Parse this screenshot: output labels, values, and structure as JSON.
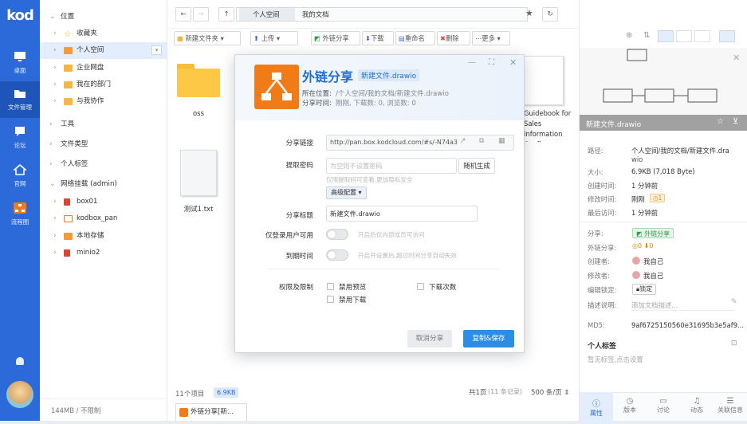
{
  "app": {
    "logo": "kod"
  },
  "nav": [
    {
      "label": "桌面",
      "icon": "desktop-icon"
    },
    {
      "label": "文件管理",
      "icon": "folder-icon"
    },
    {
      "label": "论坛",
      "icon": "chat-icon"
    },
    {
      "label": "官网",
      "icon": "home-icon"
    },
    {
      "label": "流程图",
      "icon": "flowchart-icon"
    }
  ],
  "tree": {
    "location": "位置",
    "favorites": "收藏夹",
    "personal": "个人空间",
    "enterprise": "企业网盘",
    "my_dept": "我在的部门",
    "collab": "与我协作",
    "tools": "工具",
    "filetype": "文件类型",
    "tags": "个人标签",
    "mount": "网络挂载 (admin)",
    "m1": "box01",
    "m2": "kodbox_pan",
    "m3": "本地存储",
    "m4": "minio2",
    "quota": "144MB / 不限制"
  },
  "toolbar": {
    "crumb1": "个人空间",
    "crumb2": "我的文档",
    "search": "搜索",
    "new_folder": "新建文件夹",
    "upload": "上传",
    "share": "外链分享",
    "download": "下载",
    "rename": "重命名",
    "delete": "删除",
    "more": "更多"
  },
  "files": [
    {
      "name": "oss"
    },
    {
      "name": "测试1.txt"
    },
    {
      "name": "Guidebook for Sales Information Configurat"
    }
  ],
  "footer": {
    "count": "11个项目",
    "size": "6.9KB",
    "pages": "共1页",
    "records": "(11 条记录)",
    "per_page": "500 条/页",
    "taskbar": "外链分享[新..."
  },
  "modal": {
    "title": "外链分享",
    "subtitle": "新建文件.drawio",
    "loc_label": "所在位置:",
    "loc": "/个人空间/我的文档/新建文件.drawio",
    "time_label": "分享时间:",
    "time": "刚刚, 下载数: 0, 浏览数: 0",
    "link_label": "分享链接",
    "link": "http://pan.box.kodcloud.com/#s/-N74a3",
    "pwd_label": "提取密码",
    "pwd_ph": "为空则不设置密码",
    "pwd_btn": "随机生成",
    "pwd_hint": "仅限提取码可查看,更加隐私安全",
    "adv": "高级配置",
    "stitle_label": "分享标题",
    "stitle": "新建文件.drawio",
    "login_label": "仅登录用户可用",
    "login_hint": "开启后仅内部成员可访问",
    "expire_label": "到期时间",
    "expire_hint": "开启并设置后,超过时间分享自动失效",
    "perm_label": "权限及限制",
    "p1": "禁用预览",
    "p2": "下载次数",
    "p3": "禁用下载",
    "cancel": "取消分享",
    "save": "复制&保存"
  },
  "panel": {
    "thumb_name": "新建文件.drawio",
    "path_l": "路径:",
    "path": "个人空间/我的文档/新建文件.dra",
    "path2": "wio",
    "size_l": "大小:",
    "size": "6.9KB (7,018 Byte)",
    "ctime_l": "创建时间:",
    "ctime": "1 分钟前",
    "mtime_l": "修改时间:",
    "mtime": "刚刚",
    "mver": "1",
    "atime_l": "最后访问:",
    "atime": "1 分钟前",
    "share_l": "分享:",
    "share": "外链分享",
    "ext_l": "外链分享:",
    "ext_v1": "0",
    "ext_v2": "0",
    "creator_l": "创建者:",
    "creator": "我自己",
    "modifier_l": "修改者:",
    "modifier": "我自己",
    "lock_l": "编辑锁定:",
    "lock": "锁定",
    "desc_l": "描述说明:",
    "desc": "添加文档描述...",
    "md5_l": "MD5:",
    "md5": "9af6725150560e31695b3e5af9...",
    "tags_title": "个人标签",
    "tags_empty": "暂无标签,点击设置",
    "tabs": [
      "属性",
      "版本",
      "讨论",
      "动态",
      "关联信息"
    ]
  },
  "colors": {
    "accent": "#2b6ad8",
    "modal_title": "#1f6fd1",
    "save_btn": "#2c8de6",
    "share_badge": "#2e9b45"
  }
}
